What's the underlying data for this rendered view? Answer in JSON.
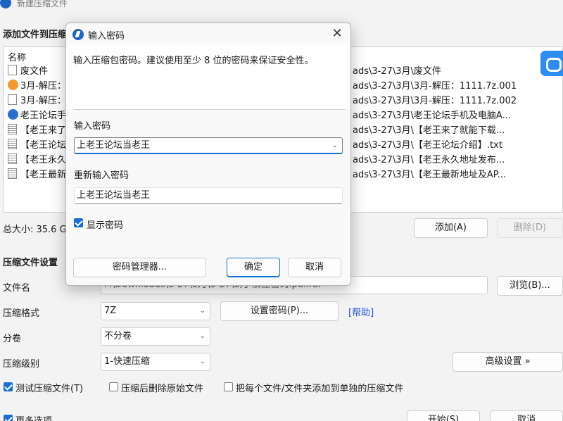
{
  "window": {
    "title": "新建压缩文件"
  },
  "files_section": {
    "title": "添加文件到压缩",
    "column_name": "名称",
    "rows": [
      {
        "name": "废文件",
        "path": "ads\\3-27\\3月\\废文件",
        "icon": "folder-file-icon"
      },
      {
        "name": "3月-解压：",
        "path": "ads\\3-27\\3月\\3月-解压：1111.7z.001",
        "icon": "rar-archive-icon"
      },
      {
        "name": "3月-解压：",
        "path": "ads\\3-27\\3月\\3月-解压：1111.7z.002",
        "icon": "file-icon"
      },
      {
        "name": "老王论坛手",
        "path": "ads\\3-27\\3月\\老王论坛手机及电脑A...",
        "icon": "app-blue-icon"
      },
      {
        "name": "【老王来了",
        "path": "ads\\3-27\\3月\\【老王来了就能下载...",
        "icon": "text-file-icon"
      },
      {
        "name": "【老王论坛",
        "path": "ads\\3-27\\3月\\【老王论坛介绍】.txt",
        "icon": "text-file-icon"
      },
      {
        "name": "【老王永久",
        "path": "ads\\3-27\\3月\\【老王永久地址发布...",
        "icon": "text-file-icon"
      },
      {
        "name": "【老王最新",
        "path": "ads\\3-27\\3月\\【老王最新地址及AP...",
        "icon": "text-file-icon"
      }
    ],
    "total_size": "总大小: 35.6 G",
    "add_label": "添加(A)",
    "delete_label": "删除(D)"
  },
  "settings": {
    "title": "压缩文件设置",
    "filename_label": "文件名",
    "filename_value": "F:\\Downloads\\3-27\\3月\\3-27\\3月-解压密码.pdf.rar",
    "browse_label": "浏览(B)...",
    "format_label": "压缩格式",
    "format_value": "7Z",
    "set_password_label": "设置密码(P)...",
    "help_label": "[帮助]",
    "split_label": "分卷",
    "split_value": "不分卷",
    "level_label": "压缩级别",
    "level_value": "1-快速压缩",
    "advanced_label": "高级设置 »",
    "test_label": "测试压缩文件(T)",
    "test_checked": true,
    "delete_after_label": "压缩后删除原始文件",
    "delete_after_checked": false,
    "separate_label": "把每个文件/文件夹添加到单独的压缩文件",
    "separate_checked": false,
    "more_label": "更多选项",
    "more_checked": true,
    "start_label": "开始(S)",
    "cancel_label": "取消"
  },
  "dialog": {
    "title": "输入密码",
    "description": "输入压缩包密码。建议使用至少 8 位的密码来保证安全性。",
    "password_label": "输入密码",
    "password_value": "上老王论坛当老王",
    "reenter_label": "重新输入密码",
    "reenter_value": "上老王论坛当老王",
    "show_password_label": "显示密码",
    "show_password_checked": true,
    "manager_label": "密码管理器...",
    "ok_label": "确定",
    "cancel_label": "取消",
    "close_glyph": "✕"
  },
  "colors": {
    "accent": "#1a6fd6",
    "link": "#1e4fd8",
    "side_logo": "#2e8df2"
  }
}
